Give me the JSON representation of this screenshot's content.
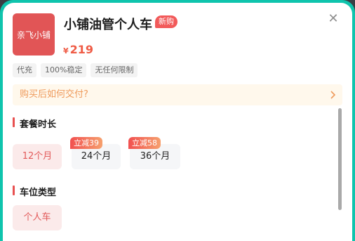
{
  "product": {
    "logo_text": "亲飞小铺",
    "title": "小铺油管个人车",
    "badge": "新购",
    "currency": "¥",
    "price": "219"
  },
  "tags": [
    "代充",
    "100%稳定",
    "无任何限制"
  ],
  "faq": {
    "label": "购买后如何交付?",
    "arrow_icon": "chevron-right-icon"
  },
  "plan_section": {
    "title": "套餐时长",
    "options": [
      {
        "label": "12个月",
        "selected": true,
        "discount": ""
      },
      {
        "label": "24个月",
        "selected": false,
        "discount": "立减39"
      },
      {
        "label": "36个月",
        "selected": false,
        "discount": "立减58"
      }
    ]
  },
  "seat_section": {
    "title": "车位类型",
    "options": [
      {
        "label": "个人车",
        "selected": true
      }
    ]
  },
  "colors": {
    "accent": "#E25A5A",
    "frame": "#0FC4AD",
    "faq_bg": "#FFF8EC"
  }
}
